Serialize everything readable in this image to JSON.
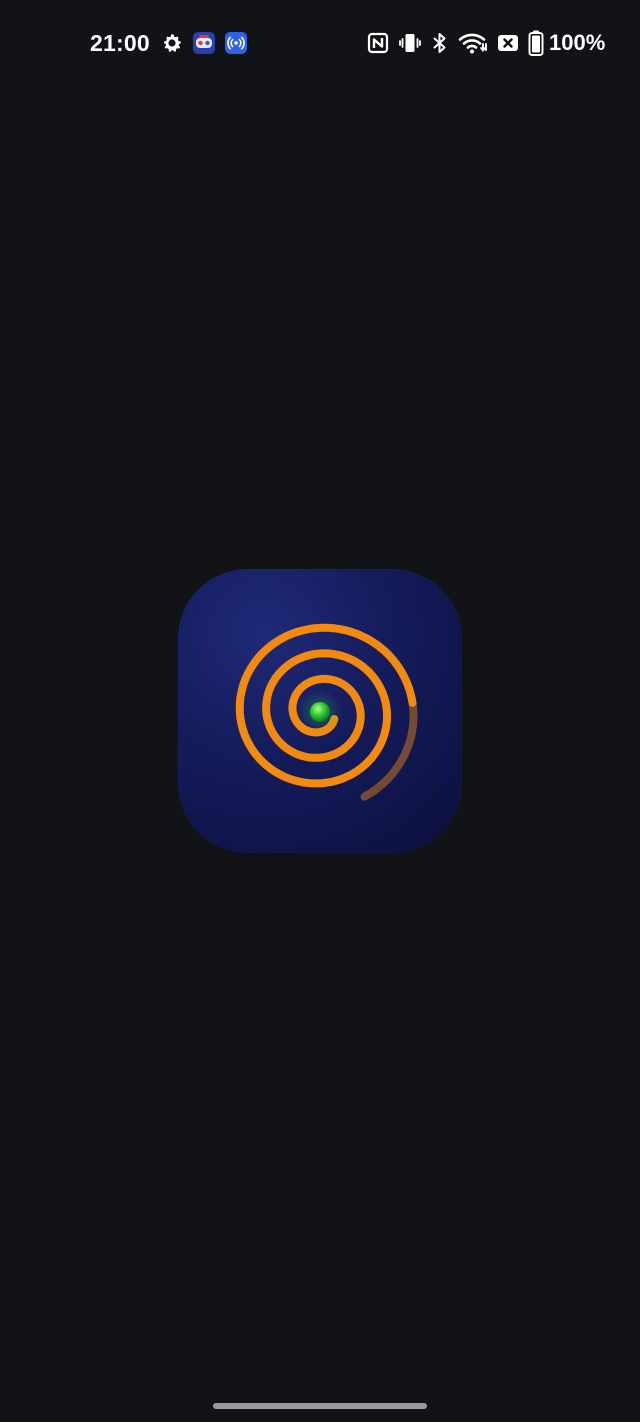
{
  "status_bar": {
    "time": "21:00",
    "battery_percent": "100%",
    "left_icons": [
      "settings-gear-icon",
      "game-app-icon",
      "broadcast-app-icon"
    ],
    "right_icons": [
      "nfc-icon",
      "vibrate-icon",
      "bluetooth-icon",
      "wifi-icon",
      "no-sim-icon",
      "battery-icon"
    ]
  },
  "splash": {
    "logo": "spiral-logo-icon",
    "colors": {
      "background": "#121317",
      "icon_background": "#141b5a",
      "spiral": "#f28a0f",
      "center_dot": "#39d43a"
    }
  },
  "navigation": {
    "gesture_bar": "home-gesture-bar"
  }
}
